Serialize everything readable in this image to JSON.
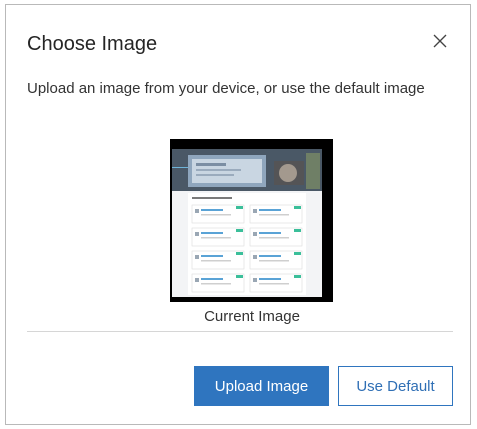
{
  "dialog": {
    "title": "Choose Image",
    "description": "Upload an image from your device, or use the default image",
    "preview_caption": "Current Image",
    "close_icon": "close-icon",
    "upload_label": "Upload Image",
    "default_label": "Use Default",
    "accent_color": "#2f75bf"
  }
}
